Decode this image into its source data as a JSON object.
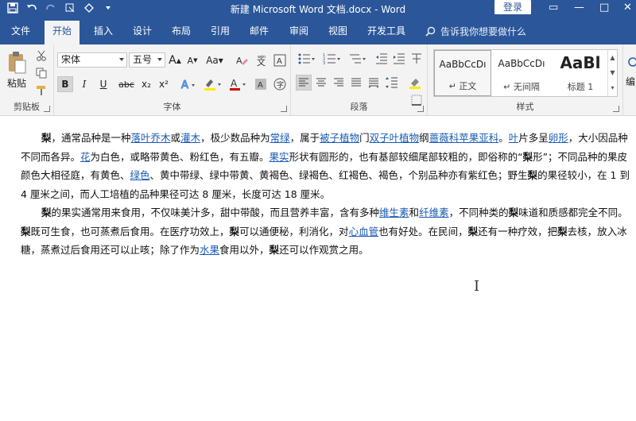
{
  "window": {
    "title": "新建 Microsoft Word 文档.docx - Word",
    "login_label": "登录"
  },
  "tabs": [
    {
      "label": "文件"
    },
    {
      "label": "开始"
    },
    {
      "label": "插入"
    },
    {
      "label": "设计"
    },
    {
      "label": "布局"
    },
    {
      "label": "引用"
    },
    {
      "label": "邮件"
    },
    {
      "label": "审阅"
    },
    {
      "label": "视图"
    },
    {
      "label": "开发工具"
    }
  ],
  "tell_me": "告诉我你想要做什么",
  "ribbon": {
    "clipboard": {
      "paste_label": "粘贴",
      "group_label": "剪贴板"
    },
    "font": {
      "font_name": "宋体",
      "font_size": "五号",
      "grow": "A",
      "shrink": "A",
      "case": "Aa",
      "bold": "B",
      "italic": "I",
      "underline": "U",
      "strike": "abc",
      "sub": "x₂",
      "sup": "x²",
      "group_label": "字体"
    },
    "paragraph": {
      "group_label": "段落"
    },
    "styles": {
      "cards": [
        {
          "sample": "AaBbCcDı",
          "name": "↵ 正文"
        },
        {
          "sample": "AaBbCcDı",
          "name": "↵ 无间隔"
        },
        {
          "sample": "AaBl",
          "name": "标题 1"
        }
      ],
      "group_label": "样式"
    },
    "editing": {
      "label": "编"
    }
  },
  "document": {
    "p1": [
      {
        "t": "梨",
        "s": "b"
      },
      {
        "t": "，通常品种是一种"
      },
      {
        "t": "落叶乔木",
        "s": "lnk"
      },
      {
        "t": "或"
      },
      {
        "t": "灌木",
        "s": "lnk"
      },
      {
        "t": "，极少数品种为"
      },
      {
        "t": "常绿",
        "s": "lnk"
      },
      {
        "t": "，属于"
      },
      {
        "t": "被子植物",
        "s": "lnk"
      },
      {
        "t": "门"
      },
      {
        "t": "双子叶植物",
        "s": "lnk"
      },
      {
        "t": "纲"
      },
      {
        "t": "蔷薇科苹果亚科",
        "s": "lnk"
      },
      {
        "t": "。"
      },
      {
        "t": "叶",
        "s": "lnk"
      },
      {
        "t": "片多呈"
      },
      {
        "t": "卵形",
        "s": "lnk"
      },
      {
        "t": "，大小因品种不同而各异。"
      },
      {
        "t": "花",
        "s": "lnk"
      },
      {
        "t": "为白色，或略带黄色、粉红色，有五瓣。"
      },
      {
        "t": "果实",
        "s": "lnk"
      },
      {
        "t": "形状有圆形的，也有基部较细尾部较粗的，即俗称的“"
      },
      {
        "t": "梨",
        "s": "b"
      },
      {
        "t": "形”；不同品种的果皮颜色大相径庭，有黄色、"
      },
      {
        "t": "绿色",
        "s": "lnk"
      },
      {
        "t": "、黄中带绿、绿中带黄、黄褐色、绿褐色、红褐色、褐色，个别品种亦有紫红色；野生"
      },
      {
        "t": "梨",
        "s": "b"
      },
      {
        "t": "的果径较小，在 1 到 4 厘米之间，而人工培植的品种果径可达 8 厘米，长度可达 18 厘米。"
      }
    ],
    "p2": [
      {
        "t": "梨",
        "s": "b"
      },
      {
        "t": "的果实通常用来食用，不仅味美汁多，甜中带酸，而且营养丰富，含有多种"
      },
      {
        "t": "维生素",
        "s": "lnk"
      },
      {
        "t": "和"
      },
      {
        "t": "纤维素",
        "s": "lnk"
      },
      {
        "t": "，不同种类的"
      },
      {
        "t": "梨",
        "s": "b"
      },
      {
        "t": "味道和质感都完全不同。"
      },
      {
        "t": "梨",
        "s": "b"
      },
      {
        "t": "既可生食，也可蒸煮后食用。在医疗功效上，"
      },
      {
        "t": "梨",
        "s": "b"
      },
      {
        "t": "可以通便秘，利消化，对"
      },
      {
        "t": "心血管",
        "s": "lnk"
      },
      {
        "t": "也有好处。在民间，"
      },
      {
        "t": "梨",
        "s": "b"
      },
      {
        "t": "还有一种疗效，把"
      },
      {
        "t": "梨",
        "s": "b"
      },
      {
        "t": "去核，放入冰糖，蒸煮过后食用还可以止咳；除了作为"
      },
      {
        "t": "水果",
        "s": "lnk"
      },
      {
        "t": "食用以外，"
      },
      {
        "t": "梨",
        "s": "b"
      },
      {
        "t": "还可以作观赏之用。"
      }
    ]
  }
}
